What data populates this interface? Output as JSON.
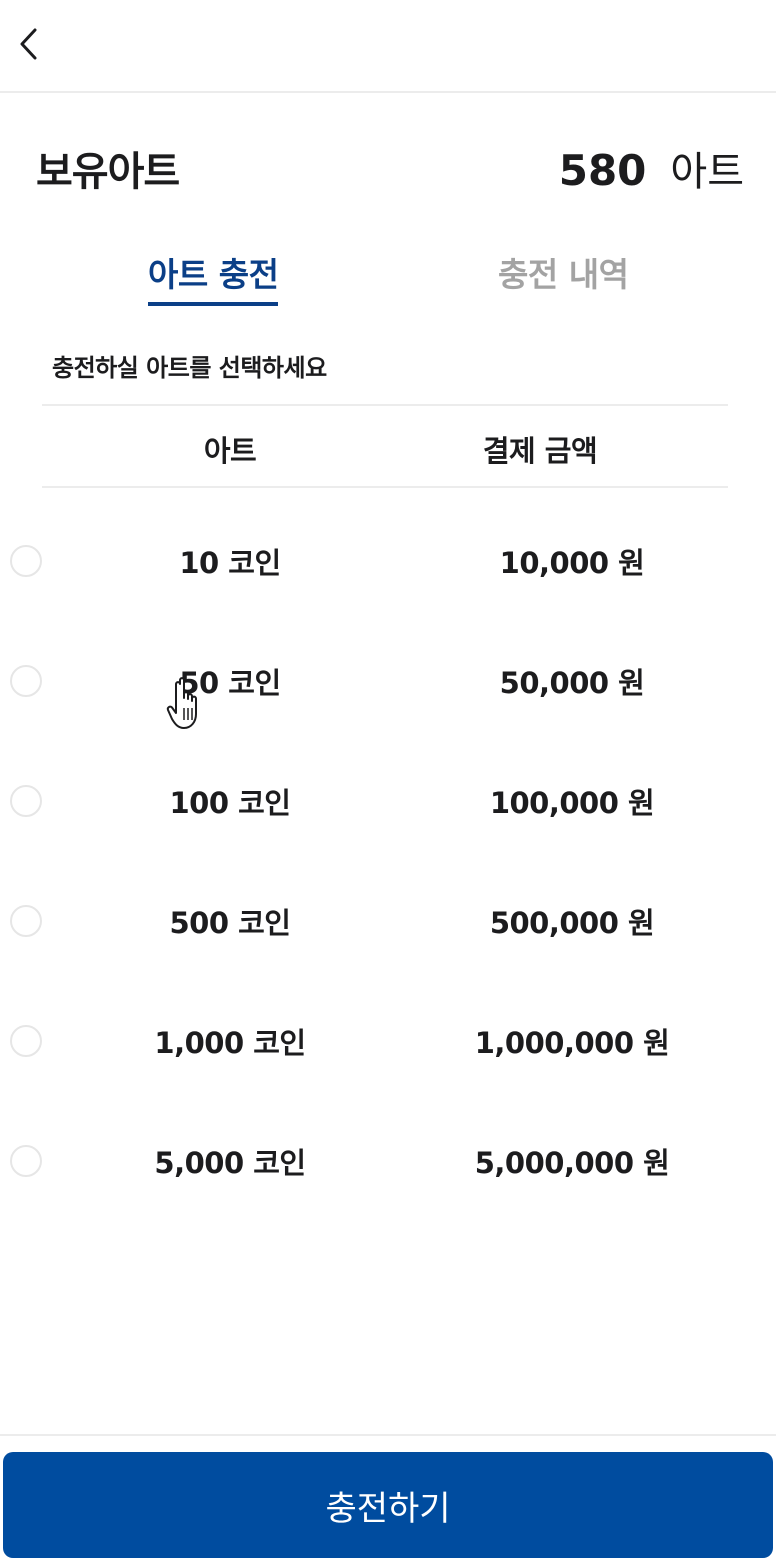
{
  "header": {
    "back_icon": "chevron-left-icon"
  },
  "balance": {
    "label": "보유아트",
    "amount": "580",
    "unit": "아트"
  },
  "tabs": [
    {
      "label": "아트 충전",
      "active": true
    },
    {
      "label": "충전 내역",
      "active": false
    }
  ],
  "instruction": "충전하실 아트를 선택하세요",
  "table": {
    "headers": {
      "art": "아트",
      "price": "결제 금액"
    },
    "rows": [
      {
        "art": "10 코인",
        "price": "10,000 원",
        "selected": false
      },
      {
        "art": "50 코인",
        "price": "50,000 원",
        "selected": false
      },
      {
        "art": "100 코인",
        "price": "100,000 원",
        "selected": false
      },
      {
        "art": "500 코인",
        "price": "500,000 원",
        "selected": false
      },
      {
        "art": "1,000 코인",
        "price": "1,000,000 원",
        "selected": false
      },
      {
        "art": "5,000 코인",
        "price": "5,000,000 원",
        "selected": false
      }
    ]
  },
  "footer": {
    "charge_button": "충전하기"
  },
  "colors": {
    "accent": "#0b3f87",
    "button": "#004c9f",
    "inactive_tab": "#a3a3a3",
    "divider": "#ececec"
  }
}
